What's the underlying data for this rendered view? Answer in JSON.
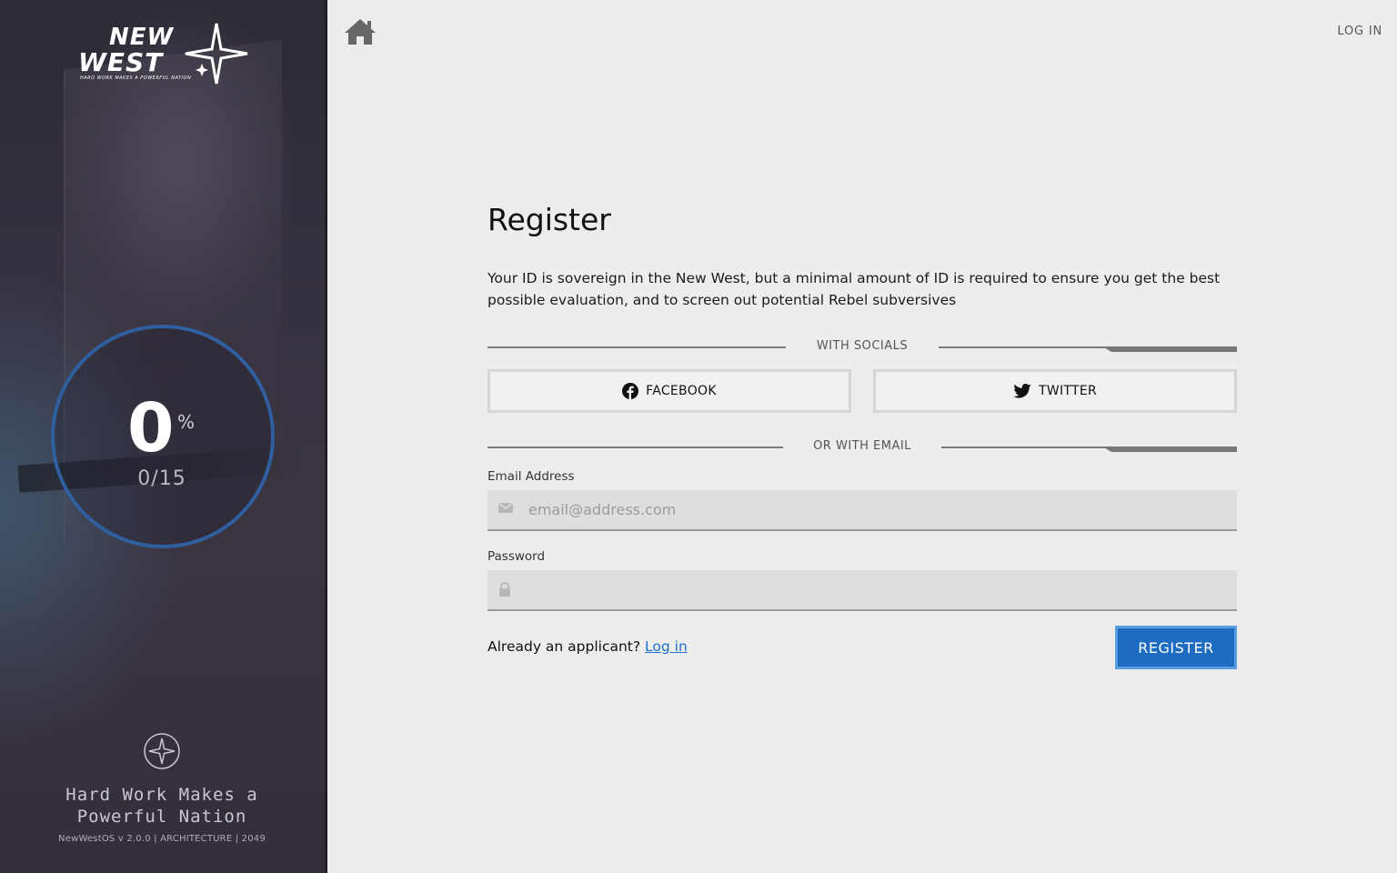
{
  "sidebar": {
    "logo": {
      "line1": "NEW",
      "line2": "WEST",
      "tagline": "HARD WORK MAKES A POWERFUL NATION"
    },
    "progress": {
      "value": "0",
      "unit": "%",
      "count": "0/15",
      "fraction": 0
    },
    "motto": "Hard Work Makes a Powerful Nation",
    "version": "NewWestOS v 2.0.0  | ARCHITECTURE | 2049"
  },
  "header": {
    "home_icon": "home-icon",
    "login_label": "LOG IN"
  },
  "form": {
    "title": "Register",
    "intro": "Your ID is sovereign in the New West, but a minimal amount of ID is required to ensure you get the best possible evaluation, and to screen out potential Rebel subversives",
    "socials_divider": "WITH SOCIALS",
    "facebook_label": "FACEBOOK",
    "twitter_label": "TWITTER",
    "email_divider": "OR WITH EMAIL",
    "email_label": "Email Address",
    "email_placeholder": "email@address.com",
    "password_label": "Password",
    "already_text": "Already an applicant?",
    "login_link": "Log in",
    "register_label": "REGISTER"
  },
  "colors": {
    "accent": "#1d6cc2",
    "ring": "#2f5f9e",
    "link": "#1f6fcf"
  }
}
